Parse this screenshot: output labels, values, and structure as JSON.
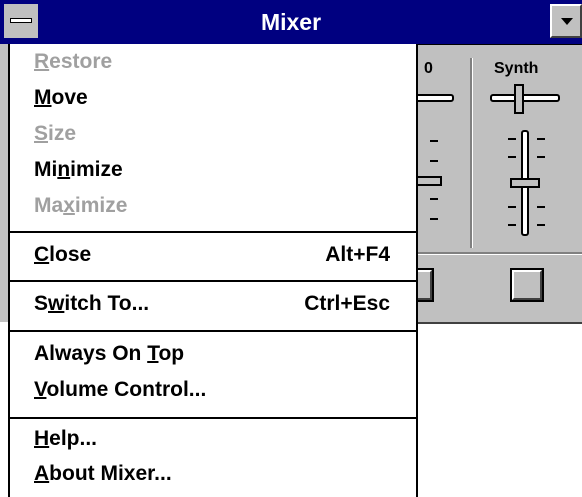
{
  "window": {
    "title": "Mixer",
    "title_bar_color": "#000080",
    "columns": [
      {
        "label": "0"
      },
      {
        "label": "Synth"
      }
    ]
  },
  "sysmenu": {
    "items": [
      {
        "pre": "",
        "u": "R",
        "post": "estore",
        "accel": "",
        "enabled": false
      },
      {
        "pre": "",
        "u": "M",
        "post": "ove",
        "accel": "",
        "enabled": true
      },
      {
        "pre": "",
        "u": "S",
        "post": "ize",
        "accel": "",
        "enabled": false
      },
      {
        "pre": "Mi",
        "u": "n",
        "post": "imize",
        "accel": "",
        "enabled": true
      },
      {
        "pre": "Ma",
        "u": "x",
        "post": "imize",
        "accel": "",
        "enabled": false
      },
      {
        "pre": "",
        "u": "C",
        "post": "lose",
        "accel": "Alt+F4",
        "enabled": true
      },
      {
        "pre": "S",
        "u": "w",
        "post": "itch To...",
        "accel": "Ctrl+Esc",
        "enabled": true
      },
      {
        "pre": "Always On ",
        "u": "T",
        "post": "op",
        "accel": "",
        "enabled": true
      },
      {
        "pre": "",
        "u": "V",
        "post": "olume Control...",
        "accel": "",
        "enabled": true
      },
      {
        "pre": "",
        "u": "H",
        "post": "elp...",
        "accel": "",
        "enabled": true
      },
      {
        "pre": "",
        "u": "A",
        "post": "bout Mixer...",
        "accel": "",
        "enabled": true
      }
    ]
  }
}
